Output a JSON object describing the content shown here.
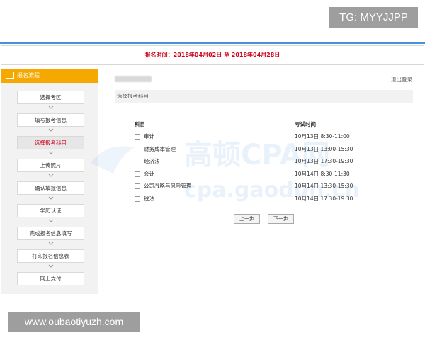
{
  "overlay": {
    "tg_label": "TG: MYYJJPP",
    "footer_url": "www.oubaotiyuzh.com"
  },
  "notice": {
    "text": "报名时间：2018年04月02日 至 2018年04月28日",
    "color": "#d0021b"
  },
  "sidebar": {
    "title": "报名流程",
    "header_color": "#f5a800",
    "steps": [
      {
        "label": "选择考区",
        "active": false
      },
      {
        "label": "填写报考信息",
        "active": false
      },
      {
        "label": "选择报考科目",
        "active": true
      },
      {
        "label": "上传照片",
        "active": false
      },
      {
        "label": "确认填报信息",
        "active": false
      },
      {
        "label": "学历认证",
        "active": false
      },
      {
        "label": "完成报名信息填写",
        "active": false
      },
      {
        "label": "打印报名信息表",
        "active": false
      },
      {
        "label": "网上支付",
        "active": false
      }
    ]
  },
  "main": {
    "logout_label": "退出登录",
    "section_title": "选择报考科目",
    "col_subject": "科目",
    "col_time": "考试时间",
    "subjects": [
      {
        "name": "审计",
        "time": "10月13日 8:30-11:00",
        "checked": false
      },
      {
        "name": "财务成本管理",
        "time": "10月13日 13:00-15:30",
        "checked": false
      },
      {
        "name": "经济法",
        "time": "10月13日 17:30-19:30",
        "checked": false
      },
      {
        "name": "会计",
        "time": "10月14日 8:30-11:30",
        "checked": false
      },
      {
        "name": "公司战略与风险管理",
        "time": "10月14日 13:30-15:30",
        "checked": false
      },
      {
        "name": "税法",
        "time": "10月14日 17:30-19:30",
        "checked": false
      }
    ],
    "prev_label": "上一步",
    "next_label": "下一步"
  },
  "watermark": {
    "line1": "高顿CPA网",
    "line2": "cpa.gaodun.cn"
  }
}
